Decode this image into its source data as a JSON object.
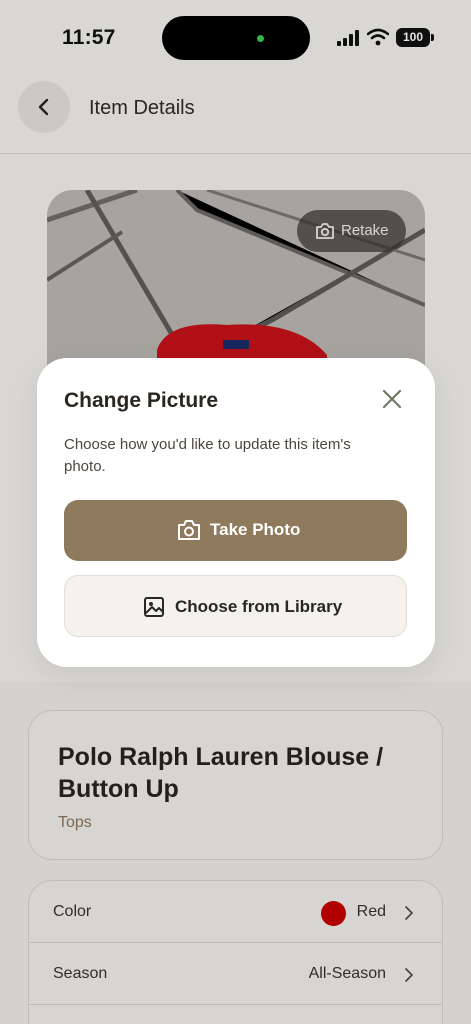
{
  "status_bar": {
    "time": "11:57",
    "battery": "100",
    "icons": [
      "signal-icon",
      "wifi-icon",
      "battery-icon"
    ]
  },
  "header": {
    "title": "Item Details",
    "back_icon": "chevron-left-icon"
  },
  "photo": {
    "retake_label": "Retake",
    "retake_icon": "camera-icon"
  },
  "item": {
    "title": "Polo Ralph Lauren Blouse / Button Up",
    "category": "Tops"
  },
  "details": [
    {
      "label": "Color",
      "value": "Red",
      "swatch": "#cc0000"
    },
    {
      "label": "Season",
      "value": "All-Season"
    }
  ],
  "modal": {
    "title": "Change Picture",
    "description": "Choose how you'd like to update this item's photo.",
    "close_icon": "close-icon",
    "take_photo_label": "Take Photo",
    "take_photo_icon": "camera-icon",
    "library_label": "Choose from Library",
    "library_icon": "image-icon"
  },
  "colors": {
    "accent": "#8f7a5d",
    "background": "#f4f2ee",
    "swatch_red": "#cc0000"
  }
}
